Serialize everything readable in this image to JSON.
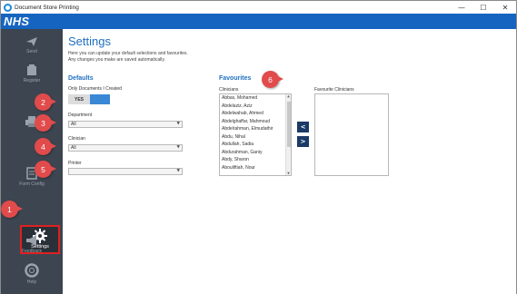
{
  "window": {
    "title": "Document Store Printing",
    "controls": {
      "minimize": "—",
      "maximize": "☐",
      "close": "✕"
    }
  },
  "brand": {
    "logo_text": "NHS",
    "color": "#1565c0"
  },
  "sidebar": {
    "items": [
      {
        "label": "Send",
        "icon": "send-icon"
      },
      {
        "label": "Register",
        "icon": "register-icon"
      },
      {
        "label": "Form Config",
        "icon": "form-config-icon"
      },
      {
        "label": "Settings",
        "icon": "gear-icon",
        "active": true
      },
      {
        "label": "Feedback",
        "icon": "megaphone-icon"
      },
      {
        "label": "Help",
        "icon": "lifebuoy-icon"
      }
    ]
  },
  "settings": {
    "title": "Settings",
    "subtitle_line1": "Here you can update your default selections and favourites.",
    "subtitle_line2": "Any changes you make are saved automatically."
  },
  "defaults": {
    "heading": "Defaults",
    "only_docs_label": "Only Documents I Created",
    "toggle_yes": "YES",
    "department_label": "Department",
    "department_value": "All",
    "clinician_label": "Clinician",
    "clinician_value": "All",
    "printer_label": "Printer",
    "printer_value": ""
  },
  "favourites": {
    "heading": "Favourites",
    "clinicians_label": "Clinicians",
    "favourite_clinicians_label": "Favourite Clinicians",
    "clinicians": [
      "Abbas, Mohamed",
      "Abdelaziz, Aziz",
      "Abdelwahab, Ahmed",
      "Abdelghaffar, Mahmoud",
      "Abdelrahman, Elmudathir",
      "Abdu, Nihal",
      "Abdullah, Sadia",
      "Abdurahman, Ganiy",
      "Abdy, Sharon",
      "Abouliftiah, Nour"
    ],
    "move_left": "<",
    "move_right": ">"
  },
  "callouts": [
    "1",
    "2",
    "3",
    "4",
    "5",
    "6"
  ],
  "colors": {
    "accent": "#1f6fbf",
    "callout": "#e14b4b",
    "sidebar": "#3d4551",
    "toggle_on": "#3a87d6"
  }
}
